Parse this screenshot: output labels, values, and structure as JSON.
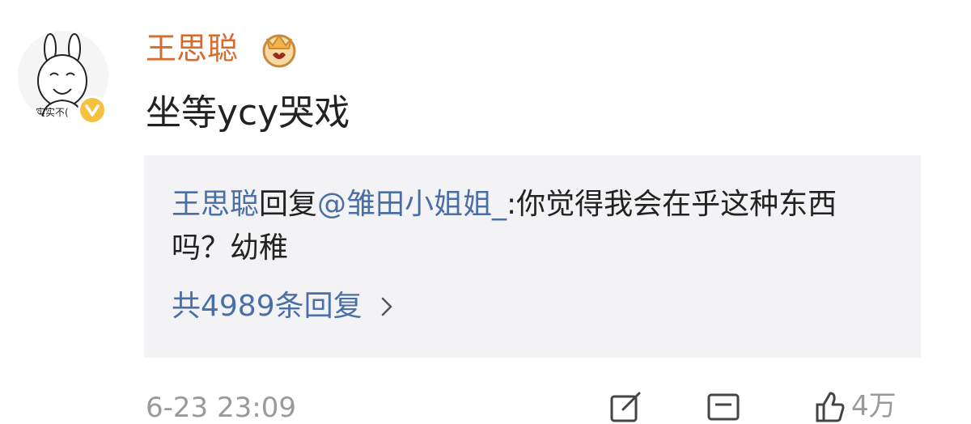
{
  "post": {
    "author": "王思聪",
    "content": "坐等ycy哭戏",
    "timestamp": "6-23 23:09",
    "avatar_caption": "实实不(",
    "icons": {
      "vip": "crown-vip-icon",
      "verified": "verified-v-icon",
      "repost": "repost-edit-icon",
      "comment": "comment-icon",
      "like": "thumbs-up-icon"
    },
    "like_count": "4万"
  },
  "reply": {
    "author": "王思聪",
    "verb": "回复",
    "mention": "@雏田小姐姐_",
    "text": ":你觉得我会在乎这种东西吗？幼稚",
    "count_label": "共4989条回复"
  },
  "colors": {
    "author": "#d86a2b",
    "link": "#4a6fa5",
    "card_bg": "#f3f3f6",
    "muted": "#9a9a9a"
  }
}
